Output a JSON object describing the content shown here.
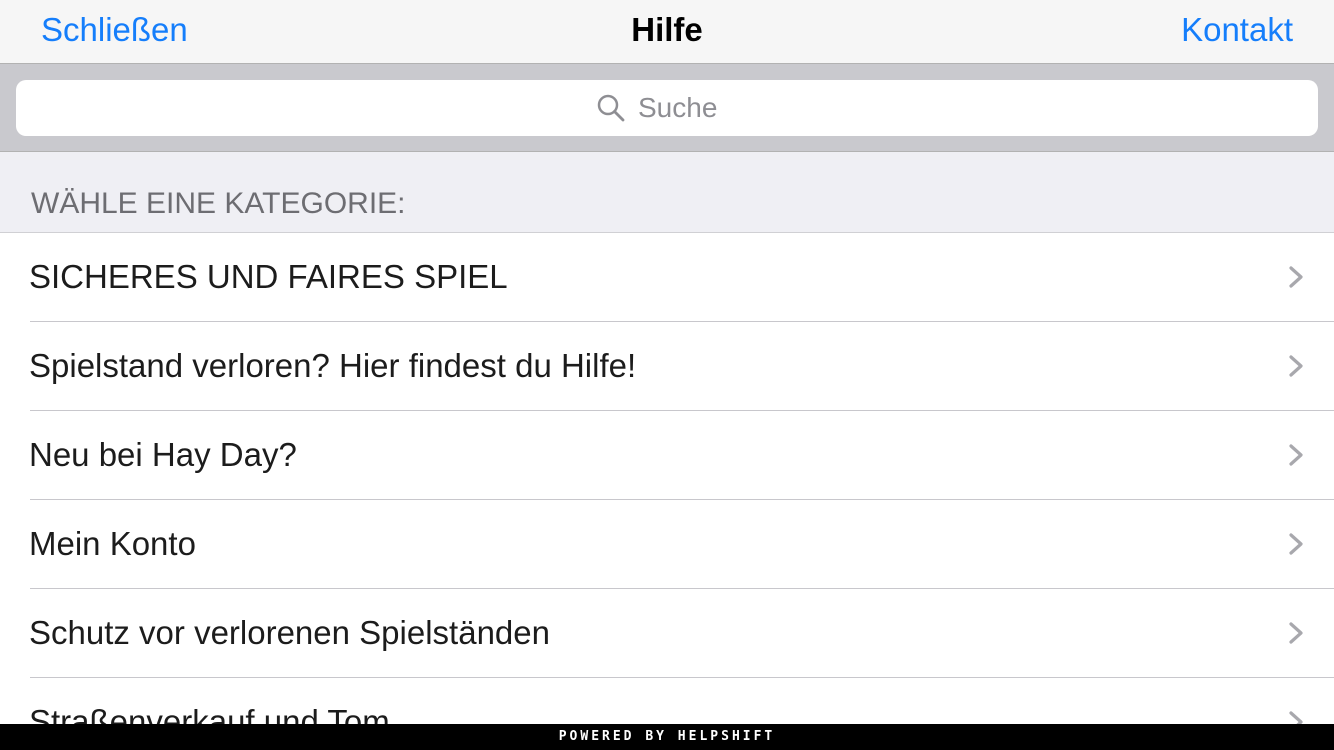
{
  "navbar": {
    "left_label": "Schließen",
    "title": "Hilfe",
    "right_label": "Kontakt"
  },
  "search": {
    "placeholder": "Suche",
    "icon": "search-icon"
  },
  "section": {
    "header": "WÄHLE EINE KATEGORIE:"
  },
  "categories": [
    {
      "label": "SICHERES UND FAIRES SPIEL"
    },
    {
      "label": "Spielstand verloren? Hier findest du Hilfe!"
    },
    {
      "label": "Neu bei Hay Day?"
    },
    {
      "label": "Mein Konto"
    },
    {
      "label": "Schutz vor verlorenen Spielständen"
    },
    {
      "label": "Straßenverkauf und Tom"
    }
  ],
  "footer": {
    "text": "POWERED BY HELPSHIFT"
  },
  "colors": {
    "accent": "#157efb",
    "searchbar_bg": "#c9c9ce",
    "section_bg": "#efeff4"
  }
}
